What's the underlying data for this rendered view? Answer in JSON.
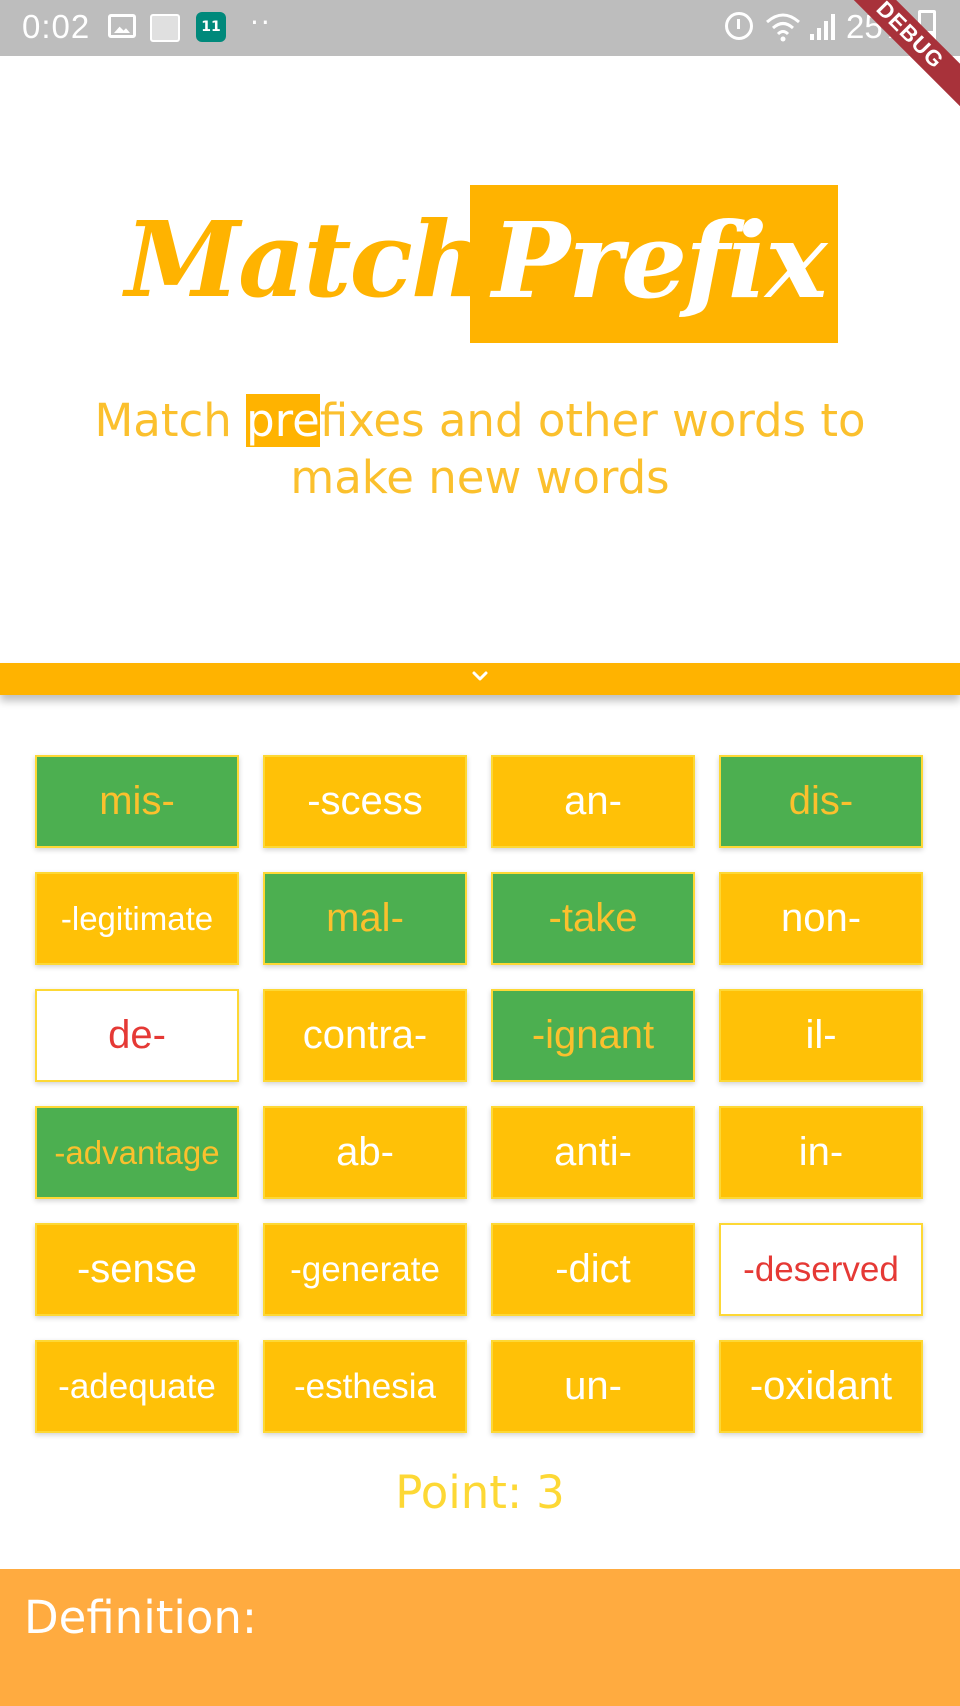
{
  "status_bar": {
    "time": "0:02",
    "calendar_day": "11",
    "battery": "25%"
  },
  "debug_banner": "DEBUG",
  "logo": {
    "word1": "Match",
    "word2": "Prefix"
  },
  "subtitle": {
    "before": "Match ",
    "highlight": "pre",
    "after": "fixes and other words to make new words"
  },
  "tiles": [
    {
      "text": "mis-",
      "state": "green"
    },
    {
      "text": "-scess",
      "state": "yellow"
    },
    {
      "text": "an-",
      "state": "yellow"
    },
    {
      "text": "dis-",
      "state": "green"
    },
    {
      "text": "-legitimate",
      "state": "yellow"
    },
    {
      "text": "mal-",
      "state": "green"
    },
    {
      "text": "-take",
      "state": "green"
    },
    {
      "text": "non-",
      "state": "yellow"
    },
    {
      "text": "de-",
      "state": "white"
    },
    {
      "text": "contra-",
      "state": "yellow"
    },
    {
      "text": "-ignant",
      "state": "green"
    },
    {
      "text": "il-",
      "state": "yellow"
    },
    {
      "text": "-advantage",
      "state": "green"
    },
    {
      "text": "ab-",
      "state": "yellow"
    },
    {
      "text": "anti-",
      "state": "yellow"
    },
    {
      "text": "in-",
      "state": "yellow"
    },
    {
      "text": "-sense",
      "state": "yellow"
    },
    {
      "text": "-generate",
      "state": "yellow"
    },
    {
      "text": "-dict",
      "state": "yellow"
    },
    {
      "text": "-deserved",
      "state": "white"
    },
    {
      "text": "-adequate",
      "state": "yellow"
    },
    {
      "text": "-esthesia",
      "state": "yellow"
    },
    {
      "text": "un-",
      "state": "yellow"
    },
    {
      "text": "-oxidant",
      "state": "yellow"
    }
  ],
  "points": {
    "label": "Point:",
    "value": "3"
  },
  "definition": {
    "label": "Definition:"
  },
  "colors": {
    "accent": "#ffb300",
    "tile_yellow": "#ffc107",
    "tile_green": "#4caf50",
    "wrong_text": "#e53935",
    "definition_bg": "#ffab40"
  },
  "icons": {
    "collapse": "chevron-down-icon"
  }
}
